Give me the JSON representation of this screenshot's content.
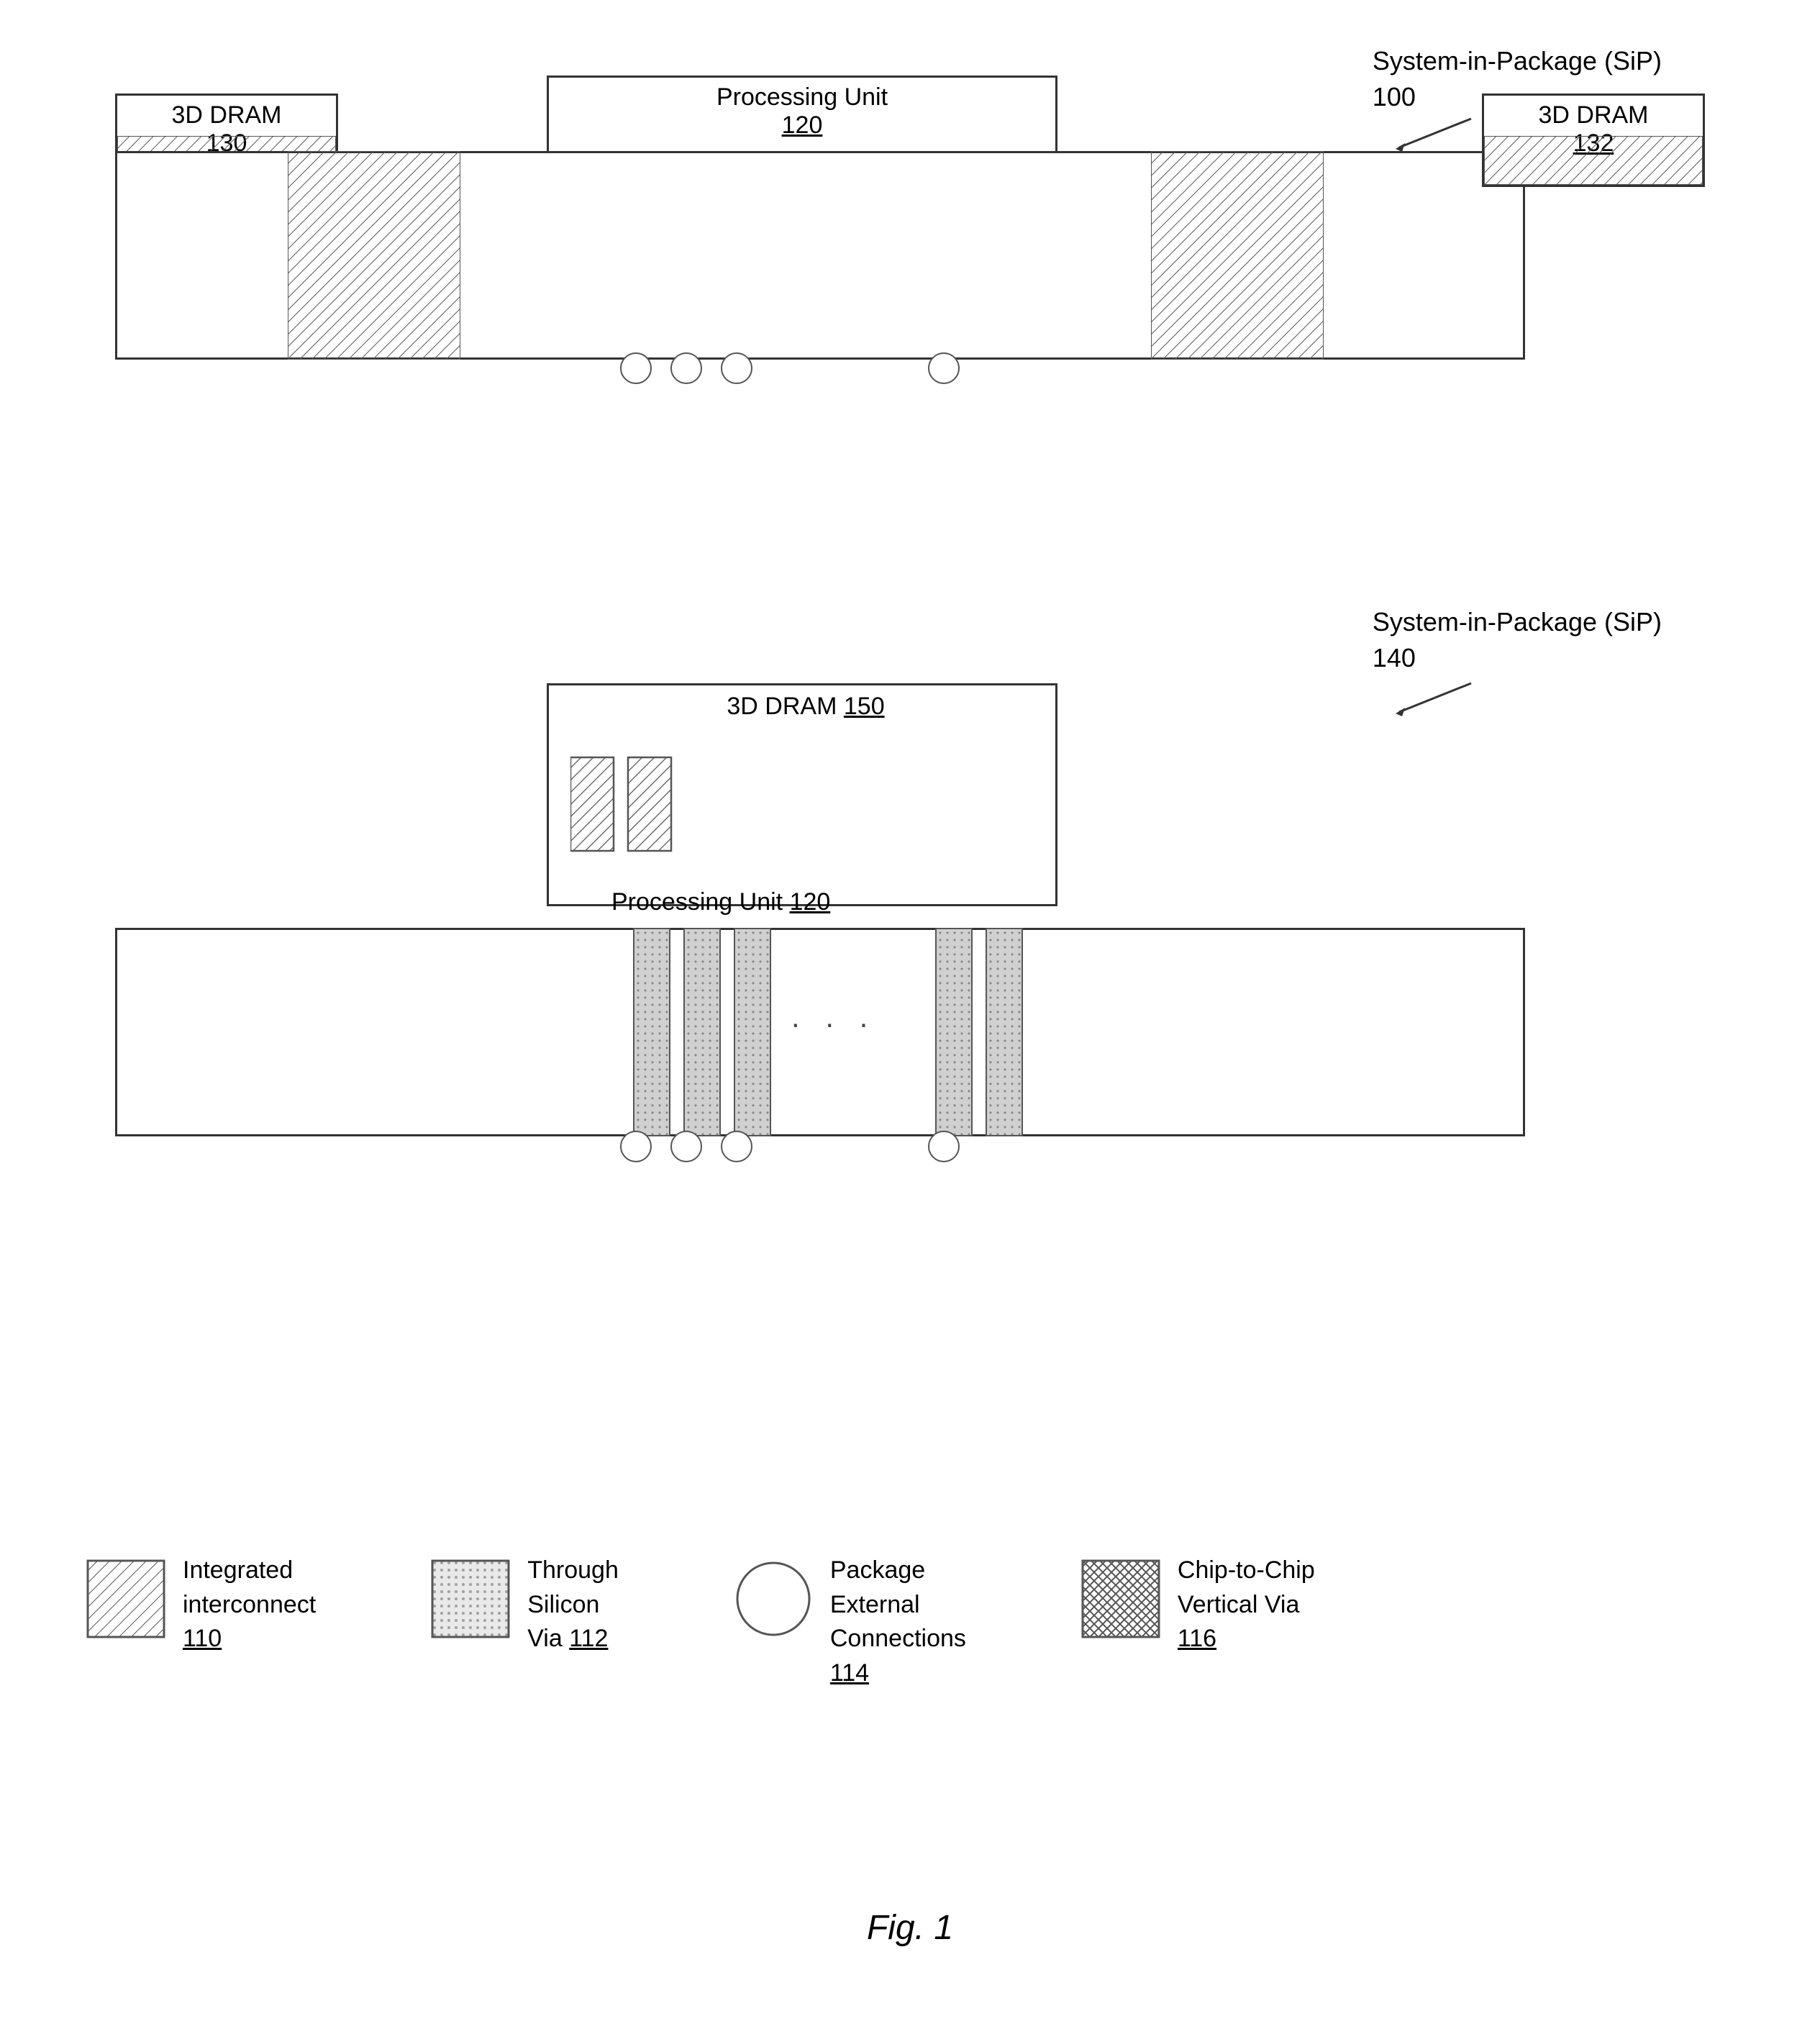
{
  "diagram1": {
    "sip_label_line1": "System-in-Package (SiP)",
    "sip_label_line2": "100",
    "dram130_line1": "3D DRAM",
    "dram130_line2": "130",
    "pu120_line1": "Processing Unit",
    "pu120_line2": "120",
    "dram132_line1": "3D DRAM",
    "dram132_line2": "132"
  },
  "diagram2": {
    "sip_label_line1": "System-in-Package (SiP)",
    "sip_label_line2": "140",
    "dram150_line1": "3D DRAM",
    "dram150_line2": "150",
    "pu120_label": "Processing Unit",
    "pu120_ref": "120"
  },
  "legend": {
    "item1_line1": "Integrated",
    "item1_line2": "interconnect",
    "item1_ref": "110",
    "item2_line1": "Through",
    "item2_line2": "Silicon",
    "item2_line3": "Via",
    "item2_ref": "112",
    "item3_line1": "Package",
    "item3_line2": "External",
    "item3_line3": "Connections",
    "item3_ref": "114",
    "item4_line1": "Chip-to-Chip",
    "item4_line2": "Vertical Via",
    "item4_ref": "116"
  },
  "figure_caption": "Fig. 1"
}
